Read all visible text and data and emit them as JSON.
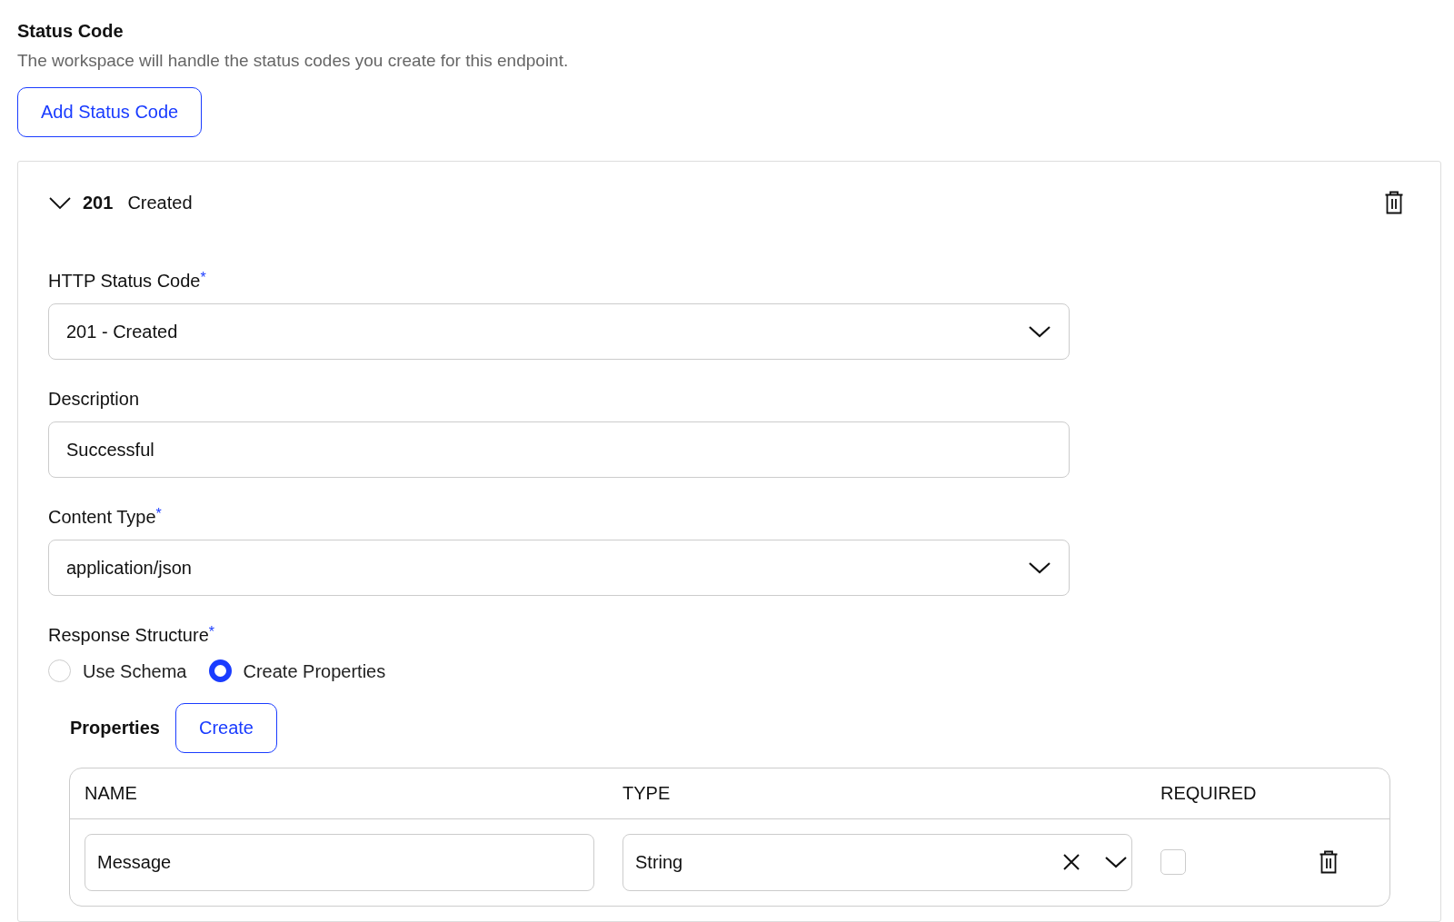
{
  "section": {
    "title": "Status Code",
    "description": "The workspace will handle the status codes you create for this endpoint.",
    "add_button": "Add Status Code"
  },
  "status_codes": [
    {
      "expanded": true,
      "code": "201",
      "name": "Created",
      "fields": [
        {
          "kind": "select",
          "label": "HTTP Status Code",
          "required_mark": "*",
          "value": "201 - Created"
        },
        {
          "kind": "text",
          "label": "Description",
          "value": "Successful"
        },
        {
          "kind": "select",
          "label": "Content Type",
          "required_mark": "*",
          "value": "application/json"
        }
      ],
      "response_structure": {
        "label": "Response Structure",
        "required_mark": "*",
        "options": [
          {
            "label": "Use Schema",
            "selected": false
          },
          {
            "label": "Create Properties",
            "selected": true
          }
        ]
      },
      "properties": {
        "label": "Properties",
        "create_button": "Create",
        "columns": [
          "NAME",
          "TYPE",
          "REQUIRED"
        ],
        "rows": [
          {
            "name": "Message",
            "type": "String",
            "required": false
          }
        ]
      }
    }
  ]
}
